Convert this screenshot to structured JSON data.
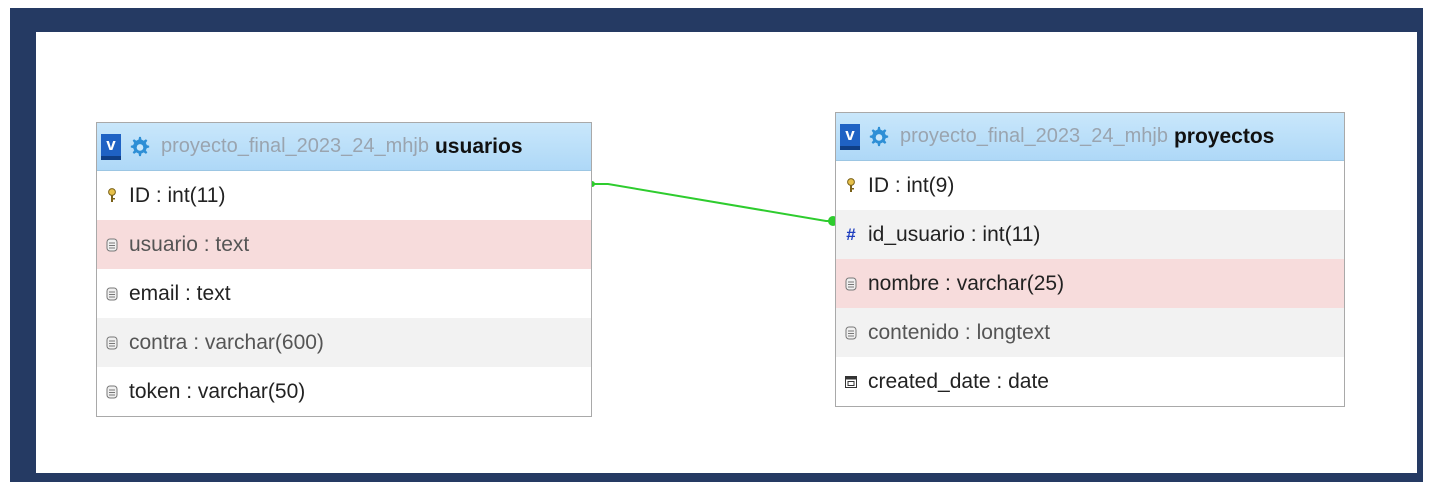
{
  "colors": {
    "frame": "#253a63",
    "header_bg": "#aed8f7",
    "highlight_row": "#f7dcdc",
    "alt_row": "#f2f2f2",
    "relation_line": "#2ecc2e",
    "toggle_bg": "#1f62c4",
    "db_name_text": "#9aa4af"
  },
  "tables": {
    "usuarios": {
      "toggle_label": "v",
      "db_name": "proyecto_final_2023_24_mhjb",
      "table_name": "usuarios",
      "columns": [
        {
          "icon": "primary-key-icon",
          "text": "ID : int(11)"
        },
        {
          "icon": "column-icon",
          "text": "usuario : text"
        },
        {
          "icon": "column-icon",
          "text": "email : text"
        },
        {
          "icon": "column-icon",
          "text": "contra : varchar(600)"
        },
        {
          "icon": "column-icon",
          "text": "token : varchar(50)"
        }
      ]
    },
    "proyectos": {
      "toggle_label": "v",
      "db_name": "proyecto_final_2023_24_mhjb",
      "table_name": "proyectos",
      "columns": [
        {
          "icon": "primary-key-icon",
          "text": "ID : int(9)"
        },
        {
          "icon": "foreign-key-hash-icon",
          "text": "id_usuario : int(11)"
        },
        {
          "icon": "column-icon",
          "text": "nombre : varchar(25)"
        },
        {
          "icon": "column-icon",
          "text": "contenido : longtext"
        },
        {
          "icon": "date-icon",
          "text": "created_date : date"
        }
      ]
    }
  }
}
